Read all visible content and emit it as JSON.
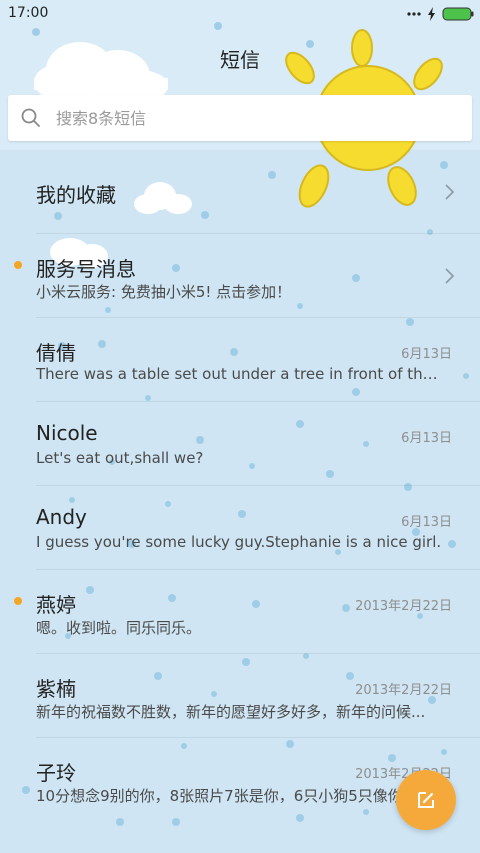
{
  "status": {
    "time": "17:00"
  },
  "header": {
    "title": "短信"
  },
  "search": {
    "placeholder": "搜索8条短信"
  },
  "folders": [
    {
      "label": "我的收藏"
    },
    {
      "label": "服务号消息",
      "preview": "小米云服务: 免费抽小米5! 点击参加！",
      "unread": true
    }
  ],
  "messages": [
    {
      "name": "倩倩",
      "preview": "There was a table set out under a tree in front of the ho...",
      "date": "6月13日",
      "unread": false
    },
    {
      "name": "Nicole",
      "preview": "Let's eat out,shall we?",
      "date": "6月13日",
      "unread": false
    },
    {
      "name": "Andy",
      "preview": "I guess you're some lucky guy.Stephanie is a nice girl.",
      "date": "6月13日",
      "unread": false
    },
    {
      "name": "燕婷",
      "preview": "嗯。收到啦。同乐同乐。",
      "date": "2013年2月22日",
      "unread": true
    },
    {
      "name": "紫楠",
      "preview": "新年的祝福数不胜数，新年的愿望好多好多，新年的问候...",
      "date": "2013年2月22日",
      "unread": false
    },
    {
      "name": "子玲",
      "preview": "10分想念9别的你，8张照片7张是你，6只小狗5只像你",
      "date": "2013年2月22日",
      "unread": false
    }
  ],
  "colors": {
    "accent": "#f6a93b",
    "unread_dot": "#f5a623",
    "background": "#cfe5f3"
  },
  "icons": {
    "compose": "compose-icon",
    "search": "search-icon",
    "chevron": "chevron-right-icon"
  }
}
